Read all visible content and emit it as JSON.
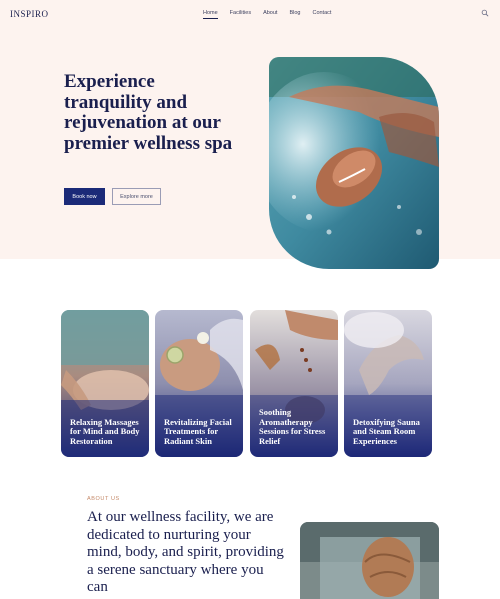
{
  "header": {
    "logo": "INSPIRO",
    "nav": [
      "Home",
      "Facilities",
      "About",
      "Blog",
      "Contact"
    ],
    "active_nav": "Home",
    "search_icon": "search-icon"
  },
  "hero": {
    "title": "Experience tranquility and rejuvenation at our premier wellness spa",
    "primary_button": "Book now",
    "secondary_button": "Explore more"
  },
  "cards": [
    {
      "title": "Relaxing Massages for Mind and Body Restoration"
    },
    {
      "title": "Revitalizing Facial Treatments for Radiant Skin"
    },
    {
      "title": "Soothing Aromatherapy Sessions for Stress Relief"
    },
    {
      "title": "Detoxifying Sauna and Steam Room Experiences"
    }
  ],
  "about": {
    "eyebrow": "ABOUT US",
    "text": "At our wellness facility, we are dedicated to nurturing your mind, body, and spirit, providing a serene sanctuary where you can"
  },
  "colors": {
    "brand_navy": "#1b2a78",
    "hero_background": "#fdf3ef",
    "accent_copper": "#c58a6a"
  }
}
